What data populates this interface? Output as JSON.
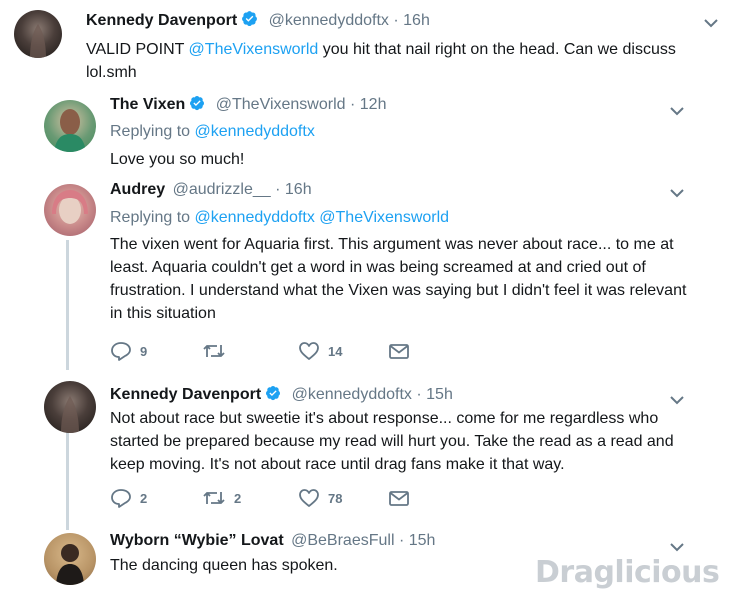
{
  "tweets": [
    {
      "name": "Kennedy Davenport",
      "handle": "@kennedyddoftx",
      "dot": "·",
      "time": "16h",
      "text_pre": "VALID POINT ",
      "text_mention": "@TheVixensworld",
      "text_post": "  you hit that nail right on the head. Can we discuss lol.smh"
    },
    {
      "name": "The Vixen",
      "handle": "@TheVixensworld",
      "dot": "·",
      "time": "12h",
      "replying_label": "Replying to ",
      "replying_mention": "@kennedyddoftx",
      "text": "Love you so much!"
    },
    {
      "name": "Audrey",
      "handle": "@audrizzle__",
      "dot": "·",
      "time": "16h",
      "replying_label": "Replying to ",
      "replying_mention": "@kennedyddoftx",
      "replying_mention2": "@TheVixensworld",
      "text": "The vixen went for Aquaria first. This argument was never about race... to me at least. Aquaria couldn't get a word in was being screamed at and cried out of frustration. I understand what the Vixen was saying but I didn't feel it was relevant in this situation",
      "replies": "9",
      "retweets": "",
      "likes": "14"
    },
    {
      "name": "Kennedy Davenport",
      "handle": "@kennedyddoftx",
      "dot": "·",
      "time": "15h",
      "text": "Not about race but sweetie it's about response... come for me regardless who started be prepared  because  my read will hurt you. Take the read as a read and keep moving. It's not about race until drag fans make it that way.",
      "replies": "2",
      "retweets": "2",
      "likes": "78"
    },
    {
      "name": "Wyborn “Wybie” Lovat",
      "handle": "@BeBraesFull",
      "dot": "·",
      "time": "15h",
      "text": "The dancing queen has spoken."
    }
  ],
  "watermark": {
    "text": "Draglicious"
  },
  "icons": {
    "verified": "verified-badge-icon",
    "caret": "chevron-down-icon",
    "reply": "reply-icon",
    "retweet": "retweet-icon",
    "like": "heart-icon",
    "dm": "envelope-icon"
  },
  "colors": {
    "link": "#1da1f2",
    "muted": "#657786",
    "thread": "#ccd6dd",
    "text": "#14171a"
  }
}
